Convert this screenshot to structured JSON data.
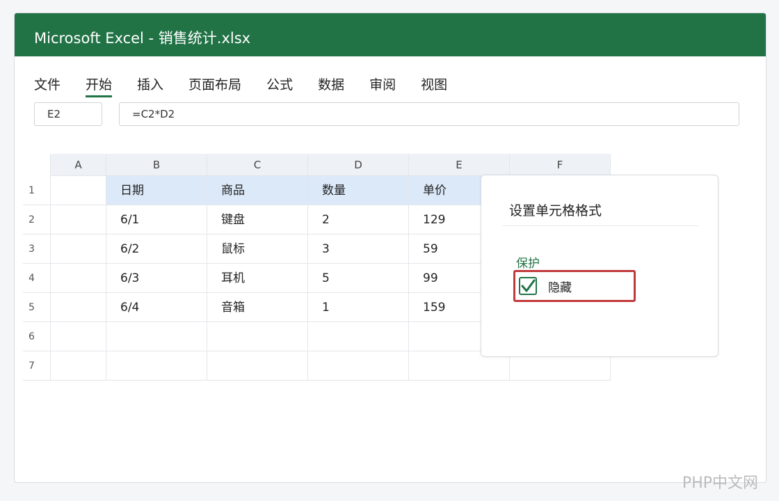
{
  "window": {
    "title": "Microsoft Excel - 销售统计.xlsx"
  },
  "menu": {
    "items": [
      {
        "label": "文件"
      },
      {
        "label": "开始"
      },
      {
        "label": "插入"
      },
      {
        "label": "页面布局"
      },
      {
        "label": "公式"
      },
      {
        "label": "数据"
      },
      {
        "label": "审阅"
      },
      {
        "label": "视图"
      }
    ],
    "active": "开始"
  },
  "formula_bar": {
    "name_box": "E2",
    "formula": "=C2*D2"
  },
  "sheet": {
    "column_headers": [
      "A",
      "B",
      "C",
      "D",
      "E",
      "F"
    ],
    "row_headers": [
      "1",
      "2",
      "3",
      "4",
      "5",
      "6",
      "7"
    ],
    "rows": [
      [
        "",
        "日期",
        "商品",
        "数量",
        "单价",
        ""
      ],
      [
        "",
        "6/1",
        "键盘",
        "2",
        "129",
        ""
      ],
      [
        "",
        "6/2",
        "鼠标",
        "3",
        "59",
        ""
      ],
      [
        "",
        "6/3",
        "耳机",
        "5",
        "99",
        ""
      ],
      [
        "",
        "6/4",
        "音箱",
        "1",
        "159",
        ""
      ],
      [
        "",
        "",
        "",
        "",
        "",
        ""
      ],
      [
        "",
        "",
        "",
        "",
        "",
        ""
      ]
    ]
  },
  "dialog": {
    "title": "设置单元格格式",
    "section": "保护",
    "checkbox_label": "隐藏",
    "checkbox_checked": true
  },
  "watermark": "PHP中文网",
  "colors": {
    "excel_green": "#217346",
    "header_fill": "#dce9f9",
    "highlight_red": "#c0393b"
  }
}
